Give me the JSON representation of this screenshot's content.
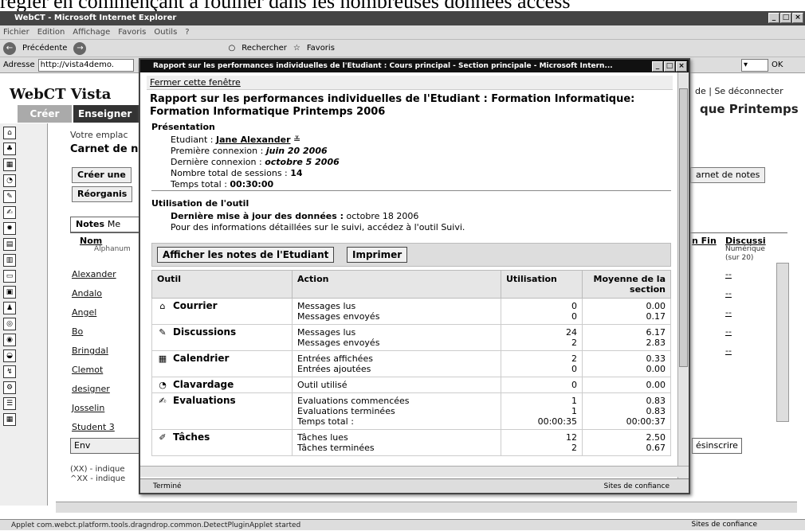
{
  "caption": "régler en commençant à fouiner dans les nombreuses données access",
  "ie": {
    "title": "WebCT - Microsoft Internet Explorer",
    "menu": [
      "Fichier",
      "Edition",
      "Affichage",
      "Favoris",
      "Outils",
      "?"
    ],
    "back": "Précédente",
    "search": "Rechercher",
    "favorites": "Favoris",
    "address_label": "Adresse",
    "address_value": "http://vista4demo.",
    "go": "OK",
    "status": "Applet com.webct.platform.tools.dragndrop.common.DetectPluginApplet started",
    "status_zone": "Sites de confiance"
  },
  "bg": {
    "logo": "WebCT Vista",
    "tab_create": "Créer",
    "tab_teach": "Enseigner",
    "title_right": "que Printemps",
    "links": "de | Se déconnecter",
    "breadcrumb": "Votre emplac",
    "carnet": "Carnet de n",
    "btn_create": "Créer une",
    "btn_reorg": "Réorganis",
    "btn_carnet": "arnet de notes",
    "tab_notes": "Notes",
    "tab_other": "Me",
    "hdr_nom": "Nom",
    "hdr_alpha": "Alphanum",
    "hdr_fin": "n Fin",
    "hdr_disc": "Discussi",
    "hdr_disc_type": "Numérique",
    "hdr_disc_max": "(sur 20)",
    "students": [
      "Alexander",
      "Andalo",
      "Angel",
      "Bo",
      "Bringdal",
      "Clemot",
      "designer",
      "Josselin",
      "Student 3"
    ],
    "dash": "--",
    "desinscrire": "ésinscrire",
    "env": "Env",
    "legend1": "(XX) - indique",
    "legend2": "^XX - indique"
  },
  "popup": {
    "title": "Rapport sur les performances individuelles de l'Etudiant : Cours principal - Section principale - Microsoft Intern...",
    "close_link": "Fermer cette fenêtre",
    "report_title": "Rapport sur les performances individuelles de l'Etudiant : Formation Informatique: Formation Informatique Printemps 2006",
    "presentation_label": "Présentation",
    "student_label": "Etudiant :",
    "student_name": "Jane Alexander",
    "first_label": "Première connexion :",
    "first_value": "juin 20 2006",
    "last_label": "Dernière connexion :",
    "last_value": "octobre 5 2006",
    "sessions_label": "Nombre total de sessions :",
    "sessions_value": "14",
    "time_label": "Temps total :",
    "time_value": "00:30:00",
    "usage_label": "Utilisation de l'outil",
    "update_label": "Dernière mise à jour des données :",
    "update_value": "octobre 18 2006",
    "detail_note": "Pour des informations détaillées sur le suivi, accédez à l'outil Suivi.",
    "btn_notes": "Afficher les notes de l'Etudiant",
    "btn_print": "Imprimer",
    "cols": [
      "Outil",
      "Action",
      "Utilisation",
      "Moyenne de la section"
    ],
    "rows": [
      {
        "tool": "Courrier",
        "icon": "⌂",
        "actions": [
          "Messages lus",
          "Messages envoyés"
        ],
        "usage": [
          "0",
          "0"
        ],
        "avg": [
          "0.00",
          "0.17"
        ]
      },
      {
        "tool": "Discussions",
        "icon": "✎",
        "actions": [
          "Messages lus",
          "Messages envoyés"
        ],
        "usage": [
          "24",
          "2"
        ],
        "avg": [
          "6.17",
          "2.83"
        ]
      },
      {
        "tool": "Calendrier",
        "icon": "▦",
        "actions": [
          "Entrées affichées",
          "Entrées ajoutées"
        ],
        "usage": [
          "2",
          "0"
        ],
        "avg": [
          "0.33",
          "0.00"
        ]
      },
      {
        "tool": "Clavardage",
        "icon": "◔",
        "actions": [
          "Outil utilisé"
        ],
        "usage": [
          "0"
        ],
        "avg": [
          "0.00"
        ]
      },
      {
        "tool": "Evaluations",
        "icon": "✍",
        "actions": [
          "Evaluations commencées",
          "Evaluations terminées",
          "Temps total :"
        ],
        "usage": [
          "1",
          "1",
          "00:00:35"
        ],
        "avg": [
          "0.83",
          "0.83",
          "00:00:37"
        ]
      },
      {
        "tool": "Tâches",
        "icon": "✐",
        "actions": [
          "Tâches lues",
          "Tâches terminées"
        ],
        "usage": [
          "12",
          "2"
        ],
        "avg": [
          "2.50",
          "0.67"
        ]
      }
    ],
    "status": "Terminé",
    "status_zone": "Sites de confiance"
  }
}
